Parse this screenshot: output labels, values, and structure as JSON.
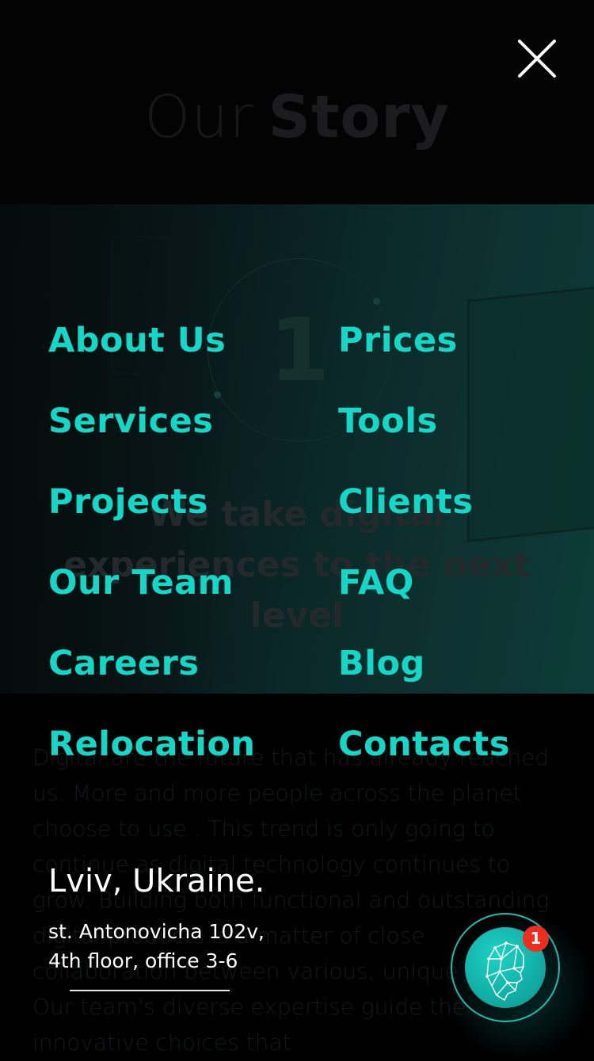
{
  "background": {
    "title_light": "Our",
    "title_bold": "Story",
    "hero_number": "1",
    "hero_text": "We take digital experiences to the next level",
    "paragraph": "Digital are the future that has already reached us. More and more people across the planet choose to use . This trend is only going to continue as digital technology continues to grow. Building both functional and outstanding digital products is a matter of close collaboration between various, unique talents. Our team's diverse expertise guide the innovative choices that"
  },
  "menu": {
    "close_icon": "close-icon",
    "left_items": [
      "About Us",
      "Services",
      "Projects",
      "Our Team",
      "Careers",
      "Relocation"
    ],
    "right_items": [
      "Prices",
      "Tools",
      "Clients",
      "FAQ",
      "Blog",
      "Contacts"
    ]
  },
  "contact": {
    "city": "Lviv, Ukraine.",
    "address_line1": "st. Antonovicha 102v,",
    "address_line2": "4th floor, office 3-6"
  },
  "chat": {
    "icon": "ai-head-icon",
    "badge_count": "1"
  },
  "colors": {
    "accent": "#11d9c7",
    "badge": "#ee2d1e",
    "background": "#000000",
    "text": "#ffffff"
  }
}
